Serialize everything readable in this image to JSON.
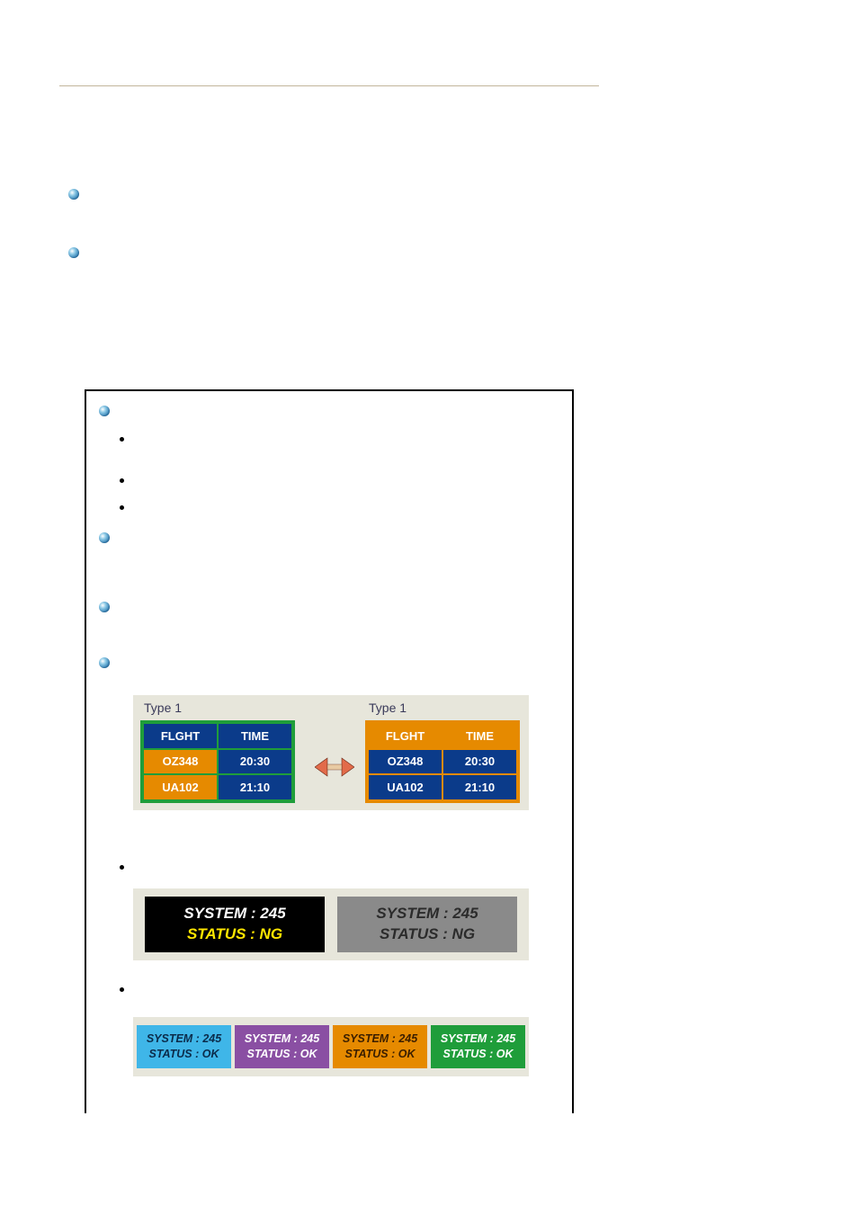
{
  "chart_data": [
    {
      "type": "table",
      "title": "Type 1",
      "border_color": "#1f9d3a",
      "columns": [
        "FLGHT",
        "TIME"
      ],
      "rows": [
        [
          "OZ348",
          "20:30"
        ],
        [
          "UA102",
          "21:10"
        ]
      ]
    },
    {
      "type": "table",
      "title": "Type 1",
      "border_color": "#e68a00",
      "columns": [
        "FLGHT",
        "TIME"
      ],
      "rows": [
        [
          "OZ348",
          "20:30"
        ],
        [
          "UA102",
          "21:10"
        ]
      ]
    }
  ],
  "panels2": [
    {
      "bg": "#000000",
      "line1": "SYSTEM : 245",
      "line2": "STATUS : NG",
      "line1_color": "#ffffff",
      "line2_color": "#ffe600"
    },
    {
      "bg": "#8a8a8a",
      "line1": "SYSTEM : 245",
      "line2": "STATUS : NG",
      "line1_color": "#2b2b2b",
      "line2_color": "#2b2b2b"
    }
  ],
  "tiles3": [
    {
      "bg": "#3fb6e8",
      "line1": "SYSTEM : 245",
      "line2": "STATUS : OK"
    },
    {
      "bg": "#8a4fa3",
      "line1": "SYSTEM : 245",
      "line2": "STATUS : OK"
    },
    {
      "bg": "#e68a00",
      "line1": "SYSTEM : 245",
      "line2": "STATUS : OK"
    },
    {
      "bg": "#1f9d3a",
      "line1": "SYSTEM : 245",
      "line2": "STATUS : OK"
    }
  ]
}
